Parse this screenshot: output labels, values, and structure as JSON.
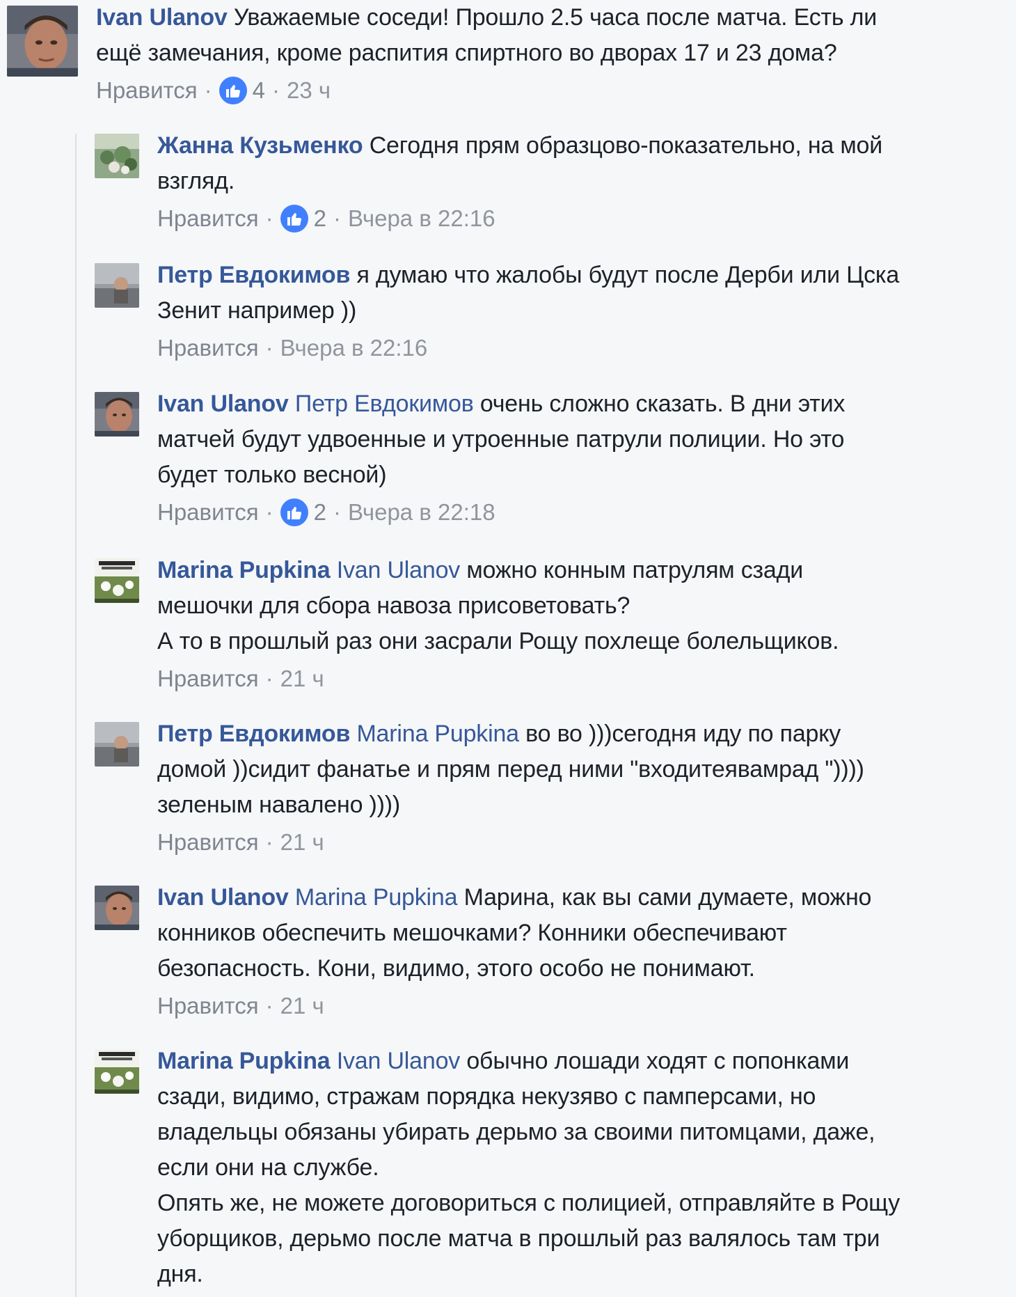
{
  "comments": [
    {
      "author": "Ivan Ulanov",
      "mention": "",
      "lines": [
        "Уважаемые соседи! Прошло 2.5 часа после матча. Есть ли",
        "ещё замечания, кроме распития спиртного во дворах 17 и 23 дома?"
      ],
      "like_label": "Нравится",
      "likes": "4",
      "time": "23 ч"
    },
    {
      "author": "Жанна Кузьменко",
      "mention": "",
      "lines": [
        "Сегодня прям образцово-показательно, на мой",
        "взгляд."
      ],
      "like_label": "Нравится",
      "likes": "2",
      "time": "Вчера в 22:16"
    },
    {
      "author": "Петр Евдокимов",
      "mention": "",
      "lines": [
        "я думаю что жалобы будут после Дерби или Цска",
        "Зенит например ))"
      ],
      "like_label": "Нравится",
      "likes": "",
      "time": "Вчера в 22:16"
    },
    {
      "author": "Ivan Ulanov",
      "mention": "Петр Евдокимов",
      "lines": [
        "очень сложно сказать. В дни этих",
        "матчей будут удвоенные и утроенные патрули полиции. Но это",
        "будет только весной)"
      ],
      "like_label": "Нравится",
      "likes": "2",
      "time": "Вчера в 22:18"
    },
    {
      "author": "Marina Pupkina",
      "mention": "Ivan Ulanov",
      "lines": [
        "можно конным патрулям сзади",
        "мешочки для сбора навоза присоветовать?",
        "А то в прошлый раз они засрали Рощу похлеще болельщиков."
      ],
      "like_label": "Нравится",
      "likes": "",
      "time": "21 ч"
    },
    {
      "author": "Петр Евдокимов",
      "mention": "Marina Pupkina",
      "lines": [
        "во во )))сегодня иду по парку",
        "домой ))сидит фанатье и прям перед ними \"входитеявамрад \"))))",
        "зеленым навалено ))))"
      ],
      "like_label": "Нравится",
      "likes": "",
      "time": "21 ч"
    },
    {
      "author": "Ivan Ulanov",
      "mention": "Marina Pupkina",
      "lines": [
        "Марина, как вы сами думаете, можно",
        "конников обеспечить мешочками? Конники обеспечивают",
        "безопасность. Кони, видимо, этого особо не понимают."
      ],
      "like_label": "Нравится",
      "likes": "",
      "time": "21 ч"
    },
    {
      "author": "Marina Pupkina",
      "mention": "Ivan Ulanov",
      "lines": [
        "обычно лошади ходят с попонками",
        "сзади, видимо, стражам порядка некузяво с памперсами, но",
        "владельцы обязаны убирать дерьмо за своими питомцами, даже,",
        "если они на службе.",
        "Опять же, не можете договориться с полицией, отправляйте в Рощу",
        "уборщиков, дерьмо после матча в прошлый раз валялось там три",
        "дня."
      ],
      "like_label": "",
      "likes": "",
      "time": ""
    }
  ],
  "colors": {
    "background": "#f6f7f9",
    "author": "#365899",
    "meta": "#90949c",
    "like_badge": "#4080ff"
  },
  "icons": {
    "like": "thumbs-up-icon"
  }
}
